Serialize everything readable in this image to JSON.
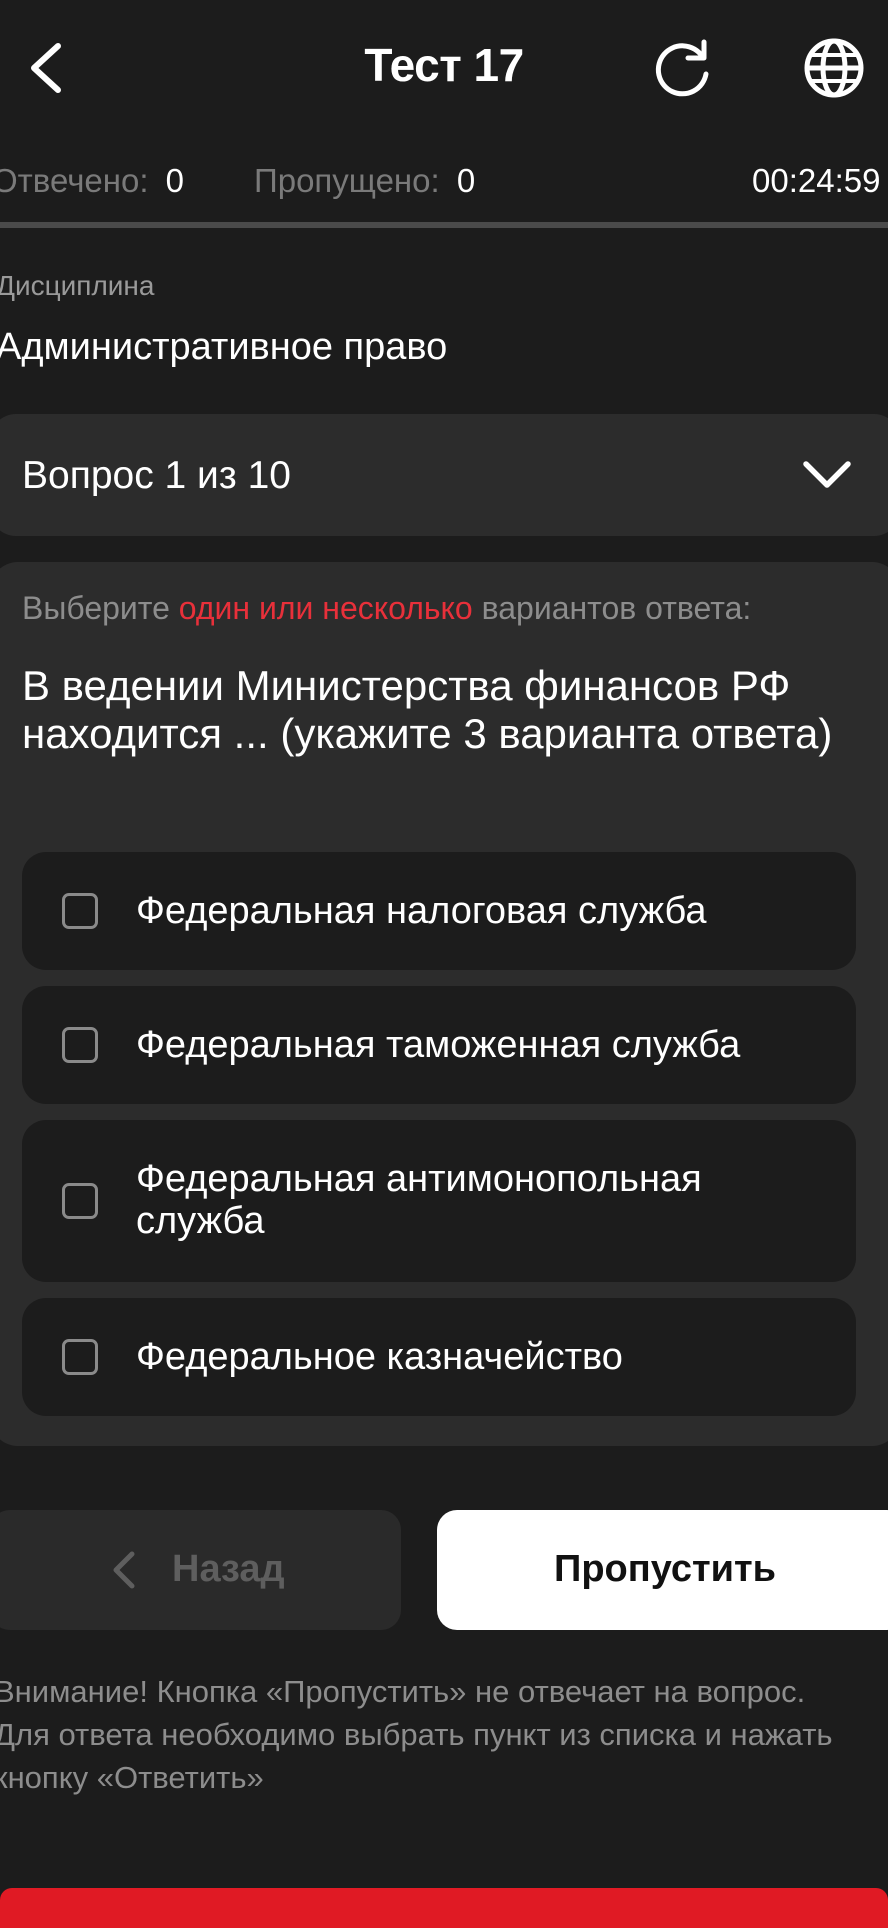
{
  "header": {
    "title": "Тест 17",
    "back_icon": "chevron-left-icon",
    "reload_icon": "reload-icon",
    "language_icon": "globe-icon"
  },
  "stats": {
    "answered_label": "Отвечено:",
    "answered_value": "0",
    "skipped_label": "Пропущено:",
    "skipped_value": "0",
    "timer": "00:24:59",
    "progress": 0
  },
  "discipline": {
    "label": "Дисциплина",
    "value": "Административное право"
  },
  "question_selector": {
    "label": "Вопрос 1 из 10",
    "icon": "chevron-down-icon"
  },
  "question": {
    "instruction_prefix": "Выберите",
    "instruction_accent": "один или несколько",
    "instruction_suffix": "вариантов ответа:",
    "text": "В ведении Министерства финансов РФ находится ... (укажите 3 варианта ответа)",
    "options": [
      {
        "label": "Федеральная налоговая служба",
        "checked": false
      },
      {
        "label": "Федеральная таможенная служба",
        "checked": false
      },
      {
        "label": "Федеральная антимонопольная служба",
        "checked": false
      },
      {
        "label": "Федеральное казначейство",
        "checked": false
      }
    ]
  },
  "buttons": {
    "back_label": "Назад",
    "skip_label": "Пропустить"
  },
  "note": "Внимание! Кнопка «Пропустить» не отвечает на вопрос. Для ответа необходимо выбрать пункт из списка и нажать кнопку «Ответить»",
  "colors": {
    "background": "#1c1c1c",
    "card": "#2c2c2c",
    "accent": "#e8303a",
    "answer_bar": "#e01a24"
  }
}
